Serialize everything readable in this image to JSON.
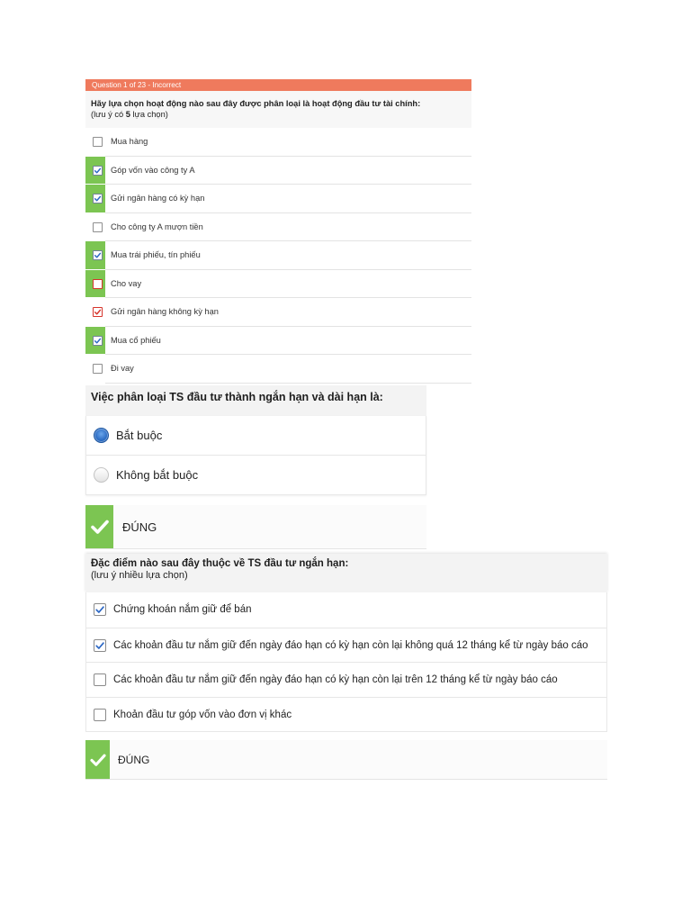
{
  "colors": {
    "header": "#ef7a5d",
    "correct": "#7cc552",
    "error": "#d6342b",
    "selected": "#2a66c4"
  },
  "icons": {
    "checkbox_mark": "checkmark-icon",
    "feedback": "check-icon"
  },
  "q1": {
    "header": "Question 1 of 23 - Incorrect",
    "question": "Hãy lựa chọn hoạt động nào sau đây được phân loại là hoạt động đầu tư tài chính:",
    "note_prefix": "(lưu ý có ",
    "note_count": "5",
    "note_suffix": " lựa chọn)",
    "options": [
      {
        "label": "Mua hàng",
        "checked": false,
        "marked_correct": false,
        "error": false
      },
      {
        "label": "Góp vốn vào công ty A",
        "checked": true,
        "marked_correct": true,
        "error": false
      },
      {
        "label": "Gửi ngân hàng có kỳ hạn",
        "checked": true,
        "marked_correct": true,
        "error": false
      },
      {
        "label": "Cho công ty A mượn tiền",
        "checked": false,
        "marked_correct": false,
        "error": false
      },
      {
        "label": "Mua trái phiếu, tín phiếu",
        "checked": true,
        "marked_correct": true,
        "error": false
      },
      {
        "label": "Cho vay",
        "checked": false,
        "marked_correct": true,
        "error": true
      },
      {
        "label": "Gửi ngân hàng không kỳ hạn",
        "checked": true,
        "marked_correct": false,
        "error": true
      },
      {
        "label": "Mua cổ phiếu",
        "checked": true,
        "marked_correct": true,
        "error": false
      },
      {
        "label": "Đi vay",
        "checked": false,
        "marked_correct": false,
        "error": false
      }
    ]
  },
  "q2": {
    "question": "Việc phân loại TS đầu tư thành ngắn hạn và dài hạn là:",
    "options": [
      {
        "label": "Bắt buộc",
        "selected": true
      },
      {
        "label": "Không bắt buộc",
        "selected": false
      }
    ],
    "feedback": "ĐÚNG"
  },
  "q3": {
    "question": "Đặc điểm nào sau đây thuộc về TS đầu tư ngắn hạn:",
    "note": "(lưu ý nhiều lựa chọn)",
    "options": [
      {
        "label": "Chứng khoán nắm giữ để bán",
        "checked": true
      },
      {
        "label": "Các khoản đầu tư nắm giữ đến ngày đáo hạn có kỳ hạn còn lại không quá 12 tháng kể từ ngày báo cáo",
        "checked": true
      },
      {
        "label": "Các khoản đầu tư nắm giữ đến ngày đáo hạn có kỳ hạn còn lại trên 12 tháng kể từ ngày báo cáo",
        "checked": false
      },
      {
        "label": "Khoản đầu tư góp vốn vào đơn vị khác",
        "checked": false
      }
    ],
    "feedback": "ĐÚNG"
  }
}
